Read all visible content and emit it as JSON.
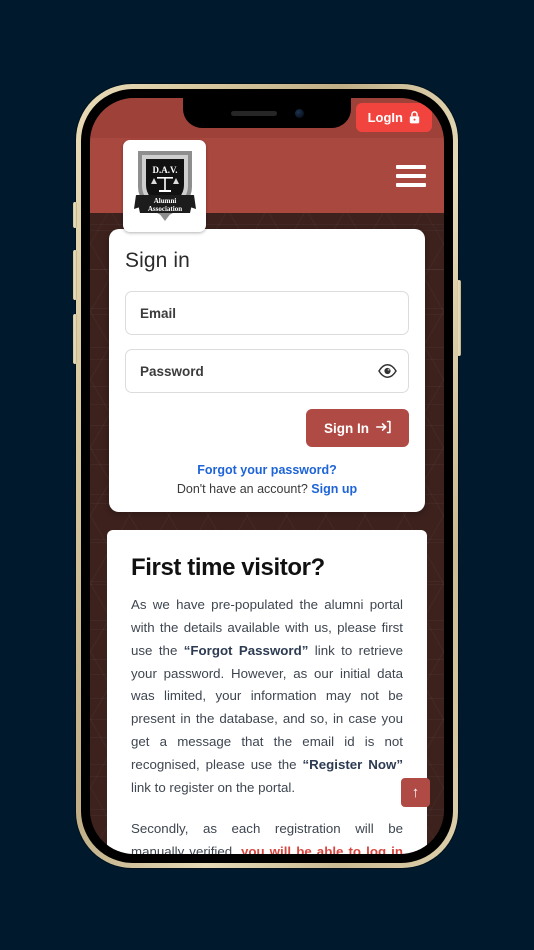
{
  "colors": {
    "page_background": "#01192c",
    "header_band": "#a9483f",
    "top_strip": "#9e4239",
    "login_button": "#f2443f",
    "signin_button": "#b04a44",
    "link_blue": "#1d64d8",
    "emphasis_red": "#d9453f",
    "phone_frame_gold": "#ded0ab",
    "pattern_maroon": "#3c211d"
  },
  "topbar": {
    "login_label": "LogIn",
    "login_icon": "lock-icon",
    "menu_icon": "hamburger-menu-icon"
  },
  "logo": {
    "title": "D.A.V.",
    "banner_line1": "Alumni",
    "banner_line2": "Association"
  },
  "signin": {
    "title": "Sign in",
    "email_placeholder": "Email",
    "email_value": "",
    "password_placeholder": "Password",
    "password_value": "",
    "password_toggle_icon": "eye-icon",
    "submit_label": "Sign In",
    "submit_icon": "sign-in-arrow-icon",
    "forgot_password_label": "Forgot your password?",
    "no_account_text": "Don't have an account?",
    "signup_label": "Sign up"
  },
  "info": {
    "heading": "First time visitor?",
    "paragraph1_part1": "As we have pre-populated the alumni portal with the details available with us, please first use the ",
    "paragraph1_bold1": "“Forgot Password”",
    "paragraph1_part2": " link to retrieve your password. However, as our initial data was limited, your information may not be present in the database, and so, in case you get a message that the email id is not recognised, please use the ",
    "paragraph1_bold2": "“Register Now”",
    "paragraph1_part3": " link to register on the portal.",
    "paragraph2_part1": "Secondly, as each registration will be manually verified, ",
    "paragraph2_red": "you will be able to log in only after you receive an email confirming the activation of your registration."
  },
  "scroll_to_top": {
    "icon": "arrow-up-icon",
    "label": "↑"
  }
}
